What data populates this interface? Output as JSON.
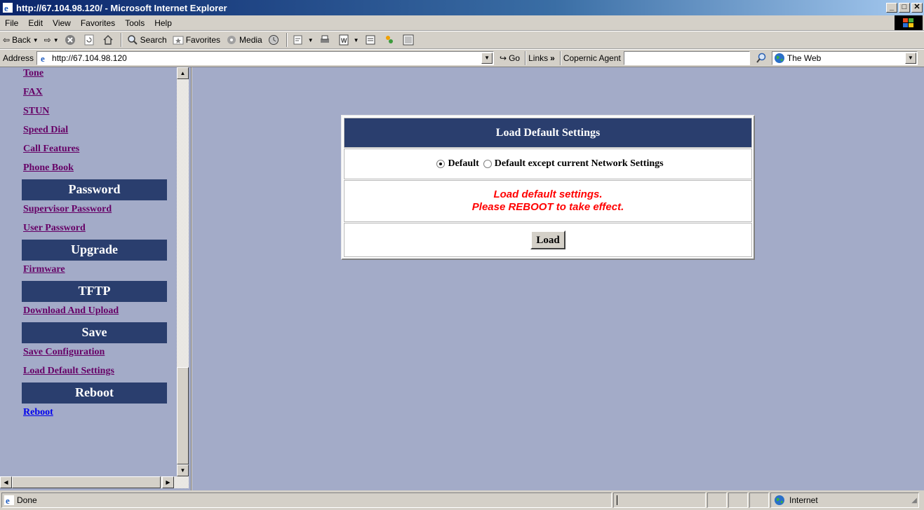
{
  "window": {
    "title": "http://67.104.98.120/ - Microsoft Internet Explorer",
    "minimize": "_",
    "maximize": "□",
    "close": "✕"
  },
  "menu": [
    "File",
    "Edit",
    "View",
    "Favorites",
    "Tools",
    "Help"
  ],
  "toolbar": {
    "back": "Back",
    "search": "Search",
    "favorites": "Favorites",
    "media": "Media"
  },
  "address": {
    "label": "Address",
    "url": "http://67.104.98.120",
    "go": "Go",
    "links": "Links",
    "links_chevron": "»",
    "copernic": "Copernic Agent",
    "the_web": "The Web"
  },
  "sidebar": {
    "items": [
      {
        "type": "link",
        "label": "Tone"
      },
      {
        "type": "link",
        "label": "FAX"
      },
      {
        "type": "link",
        "label": "STUN"
      },
      {
        "type": "link",
        "label": "Speed Dial"
      },
      {
        "type": "link",
        "label": "Call Features"
      },
      {
        "type": "link",
        "label": "Phone Book"
      },
      {
        "type": "header",
        "label": "Password"
      },
      {
        "type": "link",
        "label": "Supervisor Password"
      },
      {
        "type": "link",
        "label": "User Password"
      },
      {
        "type": "header",
        "label": "Upgrade"
      },
      {
        "type": "link",
        "label": "Firmware"
      },
      {
        "type": "header",
        "label": "TFTP"
      },
      {
        "type": "link",
        "label": "Download And Upload"
      },
      {
        "type": "header",
        "label": "Save"
      },
      {
        "type": "link",
        "label": "Save Configuration"
      },
      {
        "type": "link",
        "label": "Load Default Settings"
      },
      {
        "type": "header",
        "label": "Reboot"
      },
      {
        "type": "link",
        "label": "Reboot",
        "current": true
      }
    ]
  },
  "main": {
    "title": "Load Default Settings",
    "option_default": "Default",
    "option_except": "Default except current Network Settings",
    "selected": "Default",
    "message_line1": "Load default settings.",
    "message_line2": "Please REBOOT to take effect.",
    "load_button": "Load"
  },
  "status": {
    "text": "Done",
    "zone": "Internet"
  },
  "colors": {
    "page_bg": "#a3abc8",
    "header_bg": "#2a3e6e",
    "message": "#ff0000",
    "visited_link": "#660066"
  }
}
